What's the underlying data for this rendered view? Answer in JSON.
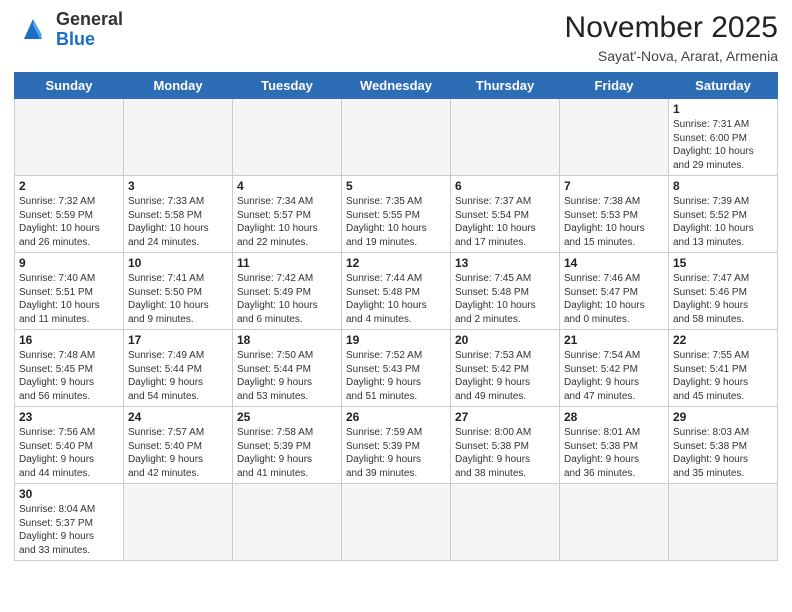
{
  "logo": {
    "general": "General",
    "blue": "Blue"
  },
  "header": {
    "month_year": "November 2025",
    "location": "Sayat'-Nova, Ararat, Armenia"
  },
  "weekdays": [
    "Sunday",
    "Monday",
    "Tuesday",
    "Wednesday",
    "Thursday",
    "Friday",
    "Saturday"
  ],
  "weeks": [
    [
      {
        "day": "",
        "info": ""
      },
      {
        "day": "",
        "info": ""
      },
      {
        "day": "",
        "info": ""
      },
      {
        "day": "",
        "info": ""
      },
      {
        "day": "",
        "info": ""
      },
      {
        "day": "",
        "info": ""
      },
      {
        "day": "1",
        "info": "Sunrise: 7:31 AM\nSunset: 6:00 PM\nDaylight: 10 hours\nand 29 minutes."
      }
    ],
    [
      {
        "day": "2",
        "info": "Sunrise: 7:32 AM\nSunset: 5:59 PM\nDaylight: 10 hours\nand 26 minutes."
      },
      {
        "day": "3",
        "info": "Sunrise: 7:33 AM\nSunset: 5:58 PM\nDaylight: 10 hours\nand 24 minutes."
      },
      {
        "day": "4",
        "info": "Sunrise: 7:34 AM\nSunset: 5:57 PM\nDaylight: 10 hours\nand 22 minutes."
      },
      {
        "day": "5",
        "info": "Sunrise: 7:35 AM\nSunset: 5:55 PM\nDaylight: 10 hours\nand 19 minutes."
      },
      {
        "day": "6",
        "info": "Sunrise: 7:37 AM\nSunset: 5:54 PM\nDaylight: 10 hours\nand 17 minutes."
      },
      {
        "day": "7",
        "info": "Sunrise: 7:38 AM\nSunset: 5:53 PM\nDaylight: 10 hours\nand 15 minutes."
      },
      {
        "day": "8",
        "info": "Sunrise: 7:39 AM\nSunset: 5:52 PM\nDaylight: 10 hours\nand 13 minutes."
      }
    ],
    [
      {
        "day": "9",
        "info": "Sunrise: 7:40 AM\nSunset: 5:51 PM\nDaylight: 10 hours\nand 11 minutes."
      },
      {
        "day": "10",
        "info": "Sunrise: 7:41 AM\nSunset: 5:50 PM\nDaylight: 10 hours\nand 9 minutes."
      },
      {
        "day": "11",
        "info": "Sunrise: 7:42 AM\nSunset: 5:49 PM\nDaylight: 10 hours\nand 6 minutes."
      },
      {
        "day": "12",
        "info": "Sunrise: 7:44 AM\nSunset: 5:48 PM\nDaylight: 10 hours\nand 4 minutes."
      },
      {
        "day": "13",
        "info": "Sunrise: 7:45 AM\nSunset: 5:48 PM\nDaylight: 10 hours\nand 2 minutes."
      },
      {
        "day": "14",
        "info": "Sunrise: 7:46 AM\nSunset: 5:47 PM\nDaylight: 10 hours\nand 0 minutes."
      },
      {
        "day": "15",
        "info": "Sunrise: 7:47 AM\nSunset: 5:46 PM\nDaylight: 9 hours\nand 58 minutes."
      }
    ],
    [
      {
        "day": "16",
        "info": "Sunrise: 7:48 AM\nSunset: 5:45 PM\nDaylight: 9 hours\nand 56 minutes."
      },
      {
        "day": "17",
        "info": "Sunrise: 7:49 AM\nSunset: 5:44 PM\nDaylight: 9 hours\nand 54 minutes."
      },
      {
        "day": "18",
        "info": "Sunrise: 7:50 AM\nSunset: 5:44 PM\nDaylight: 9 hours\nand 53 minutes."
      },
      {
        "day": "19",
        "info": "Sunrise: 7:52 AM\nSunset: 5:43 PM\nDaylight: 9 hours\nand 51 minutes."
      },
      {
        "day": "20",
        "info": "Sunrise: 7:53 AM\nSunset: 5:42 PM\nDaylight: 9 hours\nand 49 minutes."
      },
      {
        "day": "21",
        "info": "Sunrise: 7:54 AM\nSunset: 5:42 PM\nDaylight: 9 hours\nand 47 minutes."
      },
      {
        "day": "22",
        "info": "Sunrise: 7:55 AM\nSunset: 5:41 PM\nDaylight: 9 hours\nand 45 minutes."
      }
    ],
    [
      {
        "day": "23",
        "info": "Sunrise: 7:56 AM\nSunset: 5:40 PM\nDaylight: 9 hours\nand 44 minutes."
      },
      {
        "day": "24",
        "info": "Sunrise: 7:57 AM\nSunset: 5:40 PM\nDaylight: 9 hours\nand 42 minutes."
      },
      {
        "day": "25",
        "info": "Sunrise: 7:58 AM\nSunset: 5:39 PM\nDaylight: 9 hours\nand 41 minutes."
      },
      {
        "day": "26",
        "info": "Sunrise: 7:59 AM\nSunset: 5:39 PM\nDaylight: 9 hours\nand 39 minutes."
      },
      {
        "day": "27",
        "info": "Sunrise: 8:00 AM\nSunset: 5:38 PM\nDaylight: 9 hours\nand 38 minutes."
      },
      {
        "day": "28",
        "info": "Sunrise: 8:01 AM\nSunset: 5:38 PM\nDaylight: 9 hours\nand 36 minutes."
      },
      {
        "day": "29",
        "info": "Sunrise: 8:03 AM\nSunset: 5:38 PM\nDaylight: 9 hours\nand 35 minutes."
      }
    ],
    [
      {
        "day": "30",
        "info": "Sunrise: 8:04 AM\nSunset: 5:37 PM\nDaylight: 9 hours\nand 33 minutes."
      },
      {
        "day": "",
        "info": ""
      },
      {
        "day": "",
        "info": ""
      },
      {
        "day": "",
        "info": ""
      },
      {
        "day": "",
        "info": ""
      },
      {
        "day": "",
        "info": ""
      },
      {
        "day": "",
        "info": ""
      }
    ]
  ]
}
